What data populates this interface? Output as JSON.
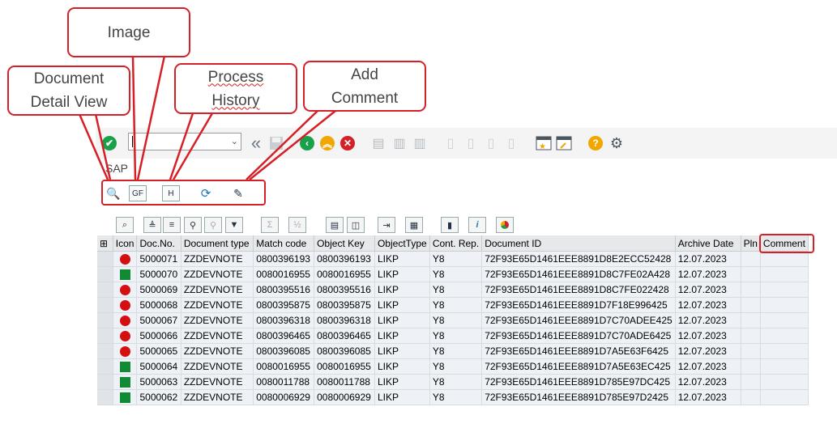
{
  "callouts": {
    "image": "Image",
    "doc_detail_line1": "Document",
    "doc_detail_line2": "Detail View",
    "process_line1": "Process",
    "process_line2": "History",
    "add_line1": "Add",
    "add_line2": "Comment"
  },
  "window": {
    "title": "SAP",
    "command_value": ""
  },
  "app_toolbar": [
    "document-detail-view-icon",
    "image-icon",
    "process-history-icon",
    "refresh-icon",
    "add-comment-icon"
  ],
  "grid": {
    "columns": [
      "Icon",
      "Doc.No.",
      "Document type",
      "Match code",
      "Object Key",
      "ObjectType",
      "Cont. Rep.",
      "Document ID",
      "Archive Date",
      "Pln",
      "Comment"
    ],
    "rows": [
      {
        "status": "red",
        "doc_no": "5000071",
        "doc_type": "ZZDEVNOTE",
        "match": "0800396193",
        "key": "0800396193",
        "otype": "LIKP",
        "rep": "Y8",
        "doc_id": "72F93E65D1461EEE8891D8E2ECC52428",
        "date": "12.07.2023",
        "pln": "",
        "comment": ""
      },
      {
        "status": "green",
        "doc_no": "5000070",
        "doc_type": "ZZDEVNOTE",
        "match": "0080016955",
        "key": "0080016955",
        "otype": "LIKP",
        "rep": "Y8",
        "doc_id": "72F93E65D1461EEE8891D8C7FE02A428",
        "date": "12.07.2023",
        "pln": "",
        "comment": ""
      },
      {
        "status": "red",
        "doc_no": "5000069",
        "doc_type": "ZZDEVNOTE",
        "match": "0800395516",
        "key": "0800395516",
        "otype": "LIKP",
        "rep": "Y8",
        "doc_id": "72F93E65D1461EEE8891D8C7FE022428",
        "date": "12.07.2023",
        "pln": "",
        "comment": ""
      },
      {
        "status": "red",
        "doc_no": "5000068",
        "doc_type": "ZZDEVNOTE",
        "match": "0800395875",
        "key": "0800395875",
        "otype": "LIKP",
        "rep": "Y8",
        "doc_id": "72F93E65D1461EEE8891D7F18E996425",
        "date": "12.07.2023",
        "pln": "",
        "comment": ""
      },
      {
        "status": "red",
        "doc_no": "5000067",
        "doc_type": "ZZDEVNOTE",
        "match": "0800396318",
        "key": "0800396318",
        "otype": "LIKP",
        "rep": "Y8",
        "doc_id": "72F93E65D1461EEE8891D7C70ADEE425",
        "date": "12.07.2023",
        "pln": "",
        "comment": ""
      },
      {
        "status": "red",
        "doc_no": "5000066",
        "doc_type": "ZZDEVNOTE",
        "match": "0800396465",
        "key": "0800396465",
        "otype": "LIKP",
        "rep": "Y8",
        "doc_id": "72F93E65D1461EEE8891D7C70ADE6425",
        "date": "12.07.2023",
        "pln": "",
        "comment": ""
      },
      {
        "status": "red",
        "doc_no": "5000065",
        "doc_type": "ZZDEVNOTE",
        "match": "0800396085",
        "key": "0800396085",
        "otype": "LIKP",
        "rep": "Y8",
        "doc_id": "72F93E65D1461EEE8891D7A5E63F6425",
        "date": "12.07.2023",
        "pln": "",
        "comment": ""
      },
      {
        "status": "green",
        "doc_no": "5000064",
        "doc_type": "ZZDEVNOTE",
        "match": "0080016955",
        "key": "0080016955",
        "otype": "LIKP",
        "rep": "Y8",
        "doc_id": "72F93E65D1461EEE8891D7A5E63EC425",
        "date": "12.07.2023",
        "pln": "",
        "comment": ""
      },
      {
        "status": "green",
        "doc_no": "5000063",
        "doc_type": "ZZDEVNOTE",
        "match": "0080011788",
        "key": "0080011788",
        "otype": "LIKP",
        "rep": "Y8",
        "doc_id": "72F93E65D1461EEE8891D785E97DC425",
        "date": "12.07.2023",
        "pln": "",
        "comment": ""
      },
      {
        "status": "green",
        "doc_no": "5000062",
        "doc_type": "ZZDEVNOTE",
        "match": "0080006929",
        "key": "0080006929",
        "otype": "LIKP",
        "rep": "Y8",
        "doc_id": "72F93E65D1461EEE8891D785E97D2425",
        "date": "12.07.2023",
        "pln": "",
        "comment": ""
      }
    ]
  },
  "colors": {
    "accent": "#d62027",
    "status_red": "#d40f0f",
    "status_green": "#108a33"
  }
}
